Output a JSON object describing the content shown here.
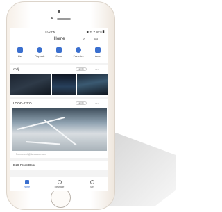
{
  "status_bar": {
    "time": "4:02 PM",
    "indicators": "◉ ✳ ▼ 59% ▊"
  },
  "header": {
    "title": "Home",
    "search_icon": "search-icon",
    "add_icon": "add-icon"
  },
  "quick_actions": [
    {
      "label": "Live",
      "icon": "live-icon"
    },
    {
      "label": "Playback",
      "icon": "playback-icon"
    },
    {
      "label": "Cloud",
      "icon": "cloud-icon"
    },
    {
      "label": "Favorites",
      "icon": "favorites-icon"
    },
    {
      "label": "Acce",
      "icon": "access-icon"
    }
  ],
  "groups": [
    {
      "name": "chdj",
      "status": "● ON"
    },
    {
      "name": "LOOC-47CO",
      "status": "● ON",
      "caption": "From: zoru.li@dahuatech.com"
    },
    {
      "name": "D28-Front Door"
    }
  ],
  "tab_bar": [
    {
      "label": "Home",
      "active": true
    },
    {
      "label": "Message",
      "active": false
    },
    {
      "label": "Me",
      "active": false
    }
  ],
  "colors": {
    "accent": "#3a6fcf"
  }
}
